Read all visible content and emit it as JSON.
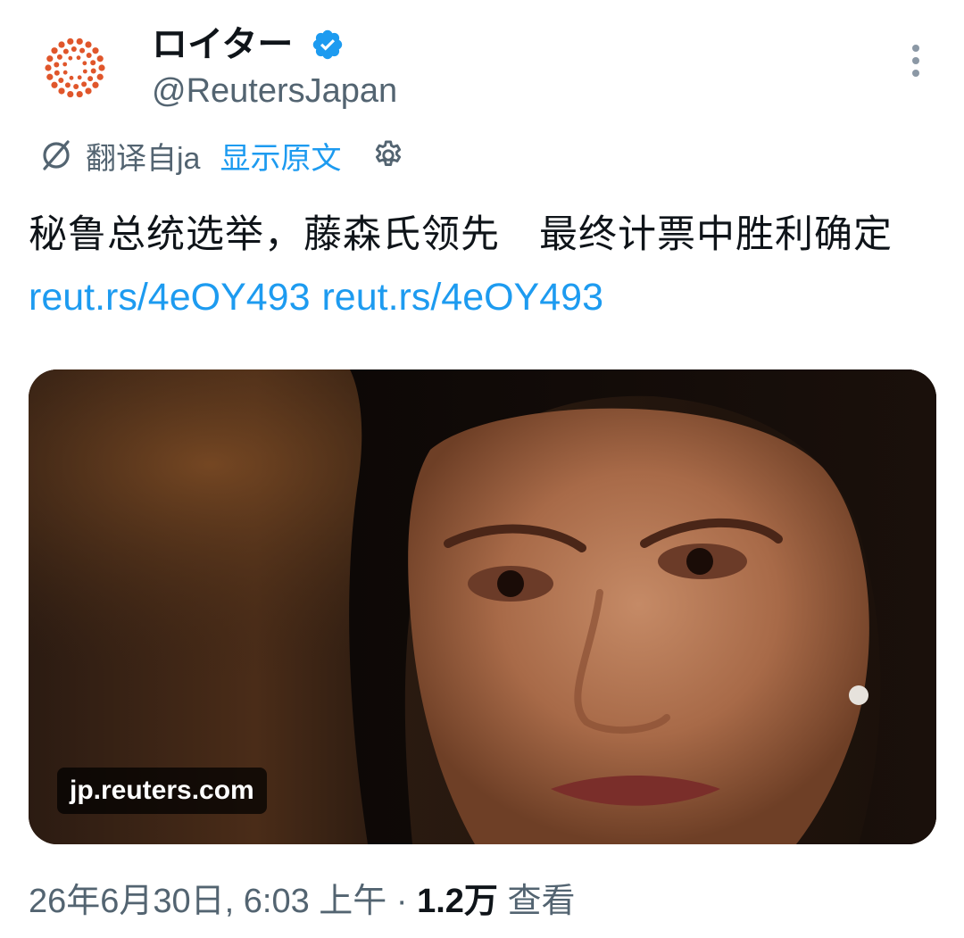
{
  "account": {
    "display_name": "ロイター",
    "handle": "@ReutersJapan",
    "verified": true,
    "avatar_icon": "reuters-logo-icon"
  },
  "translation": {
    "translated_from": "翻译自ja",
    "show_original": "显示原文"
  },
  "tweet": {
    "text": "秘鲁总统选举，藤森氏领先　最终计票中胜利确定 ",
    "link_1": "reut.rs/4eOY493",
    "link_2": "reut.rs/4eOY493"
  },
  "media": {
    "domain": "jp.reuters.com"
  },
  "meta": {
    "timestamp": "26年6月30日, 6:03 上午",
    "separator": " · ",
    "views_count": "1.2万",
    "views_label": " 查看"
  },
  "colors": {
    "accent": "#1d9bf0",
    "secondary_text": "#536471",
    "brand_orange": "#e0562b"
  }
}
